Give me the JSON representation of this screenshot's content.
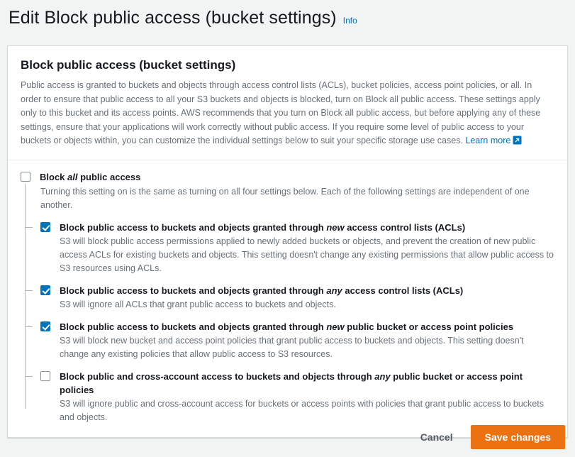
{
  "page": {
    "title": "Edit Block public access (bucket settings)",
    "info_label": "Info"
  },
  "card": {
    "title": "Block public access (bucket settings)",
    "description": "Public access is granted to buckets and objects through access control lists (ACLs), bucket policies, access point policies, or all. In order to ensure that public access to all your S3 buckets and objects is blocked, turn on Block all public access. These settings apply only to this bucket and its access points. AWS recommends that you turn on Block all public access, but before applying any of these settings, ensure that your applications will work correctly without public access. If you require some level of public access to your buckets or objects within, you can customize the individual settings below to suit your specific storage use cases. ",
    "learn_more_label": "Learn more",
    "external_link_icon": "external-link-icon"
  },
  "settings": {
    "parent": {
      "label_prefix": "Block ",
      "label_emphasis": "all",
      "label_suffix": " public access",
      "description": "Turning this setting on is the same as turning on all four settings below. Each of the following settings are independent of one another.",
      "checked": false
    },
    "children": [
      {
        "label_prefix": "Block public access to buckets and objects granted through ",
        "label_emphasis": "new",
        "label_suffix": " access control lists (ACLs)",
        "description": "S3 will block public access permissions applied to newly added buckets or objects, and prevent the creation of new public access ACLs for existing buckets and objects. This setting doesn't change any existing permissions that allow public access to S3 resources using ACLs.",
        "checked": true
      },
      {
        "label_prefix": "Block public access to buckets and objects granted through ",
        "label_emphasis": "any",
        "label_suffix": " access control lists (ACLs)",
        "description": "S3 will ignore all ACLs that grant public access to buckets and objects.",
        "checked": true
      },
      {
        "label_prefix": "Block public access to buckets and objects granted through ",
        "label_emphasis": "new",
        "label_suffix": " public bucket or access point policies",
        "description": "S3 will block new bucket and access point policies that grant public access to buckets and objects. This setting doesn't change any existing policies that allow public access to S3 resources.",
        "checked": true
      },
      {
        "label_prefix": "Block public and cross-account access to buckets and objects through ",
        "label_emphasis": "any",
        "label_suffix": " public bucket or access point policies",
        "description": "S3 will ignore public and cross-account access for buckets or access points with policies that grant public access to buckets and objects.",
        "checked": false
      }
    ]
  },
  "footer": {
    "cancel_label": "Cancel",
    "save_label": "Save changes"
  },
  "colors": {
    "accent_blue": "#0073bb",
    "primary_orange": "#ec7211",
    "page_background": "#f2f3f3",
    "text_dark": "#16191f",
    "text_muted": "#687078"
  }
}
